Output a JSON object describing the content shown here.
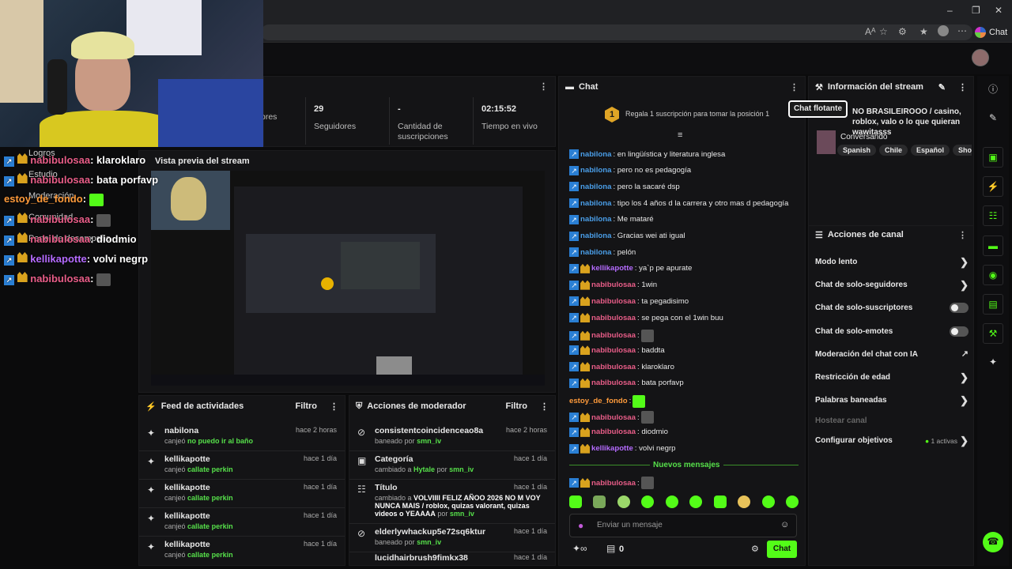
{
  "browser": {
    "copilot_label": "Chat",
    "font_size_glyph": "Aᴬ"
  },
  "stats": {
    "items": [
      {
        "value": "",
        "label": "ores"
      },
      {
        "value": "29",
        "label": "Seguidores"
      },
      {
        "value": "-",
        "label": "Cantidad de suscripciones"
      },
      {
        "value": "02:15:52",
        "label": "Tiempo en vivo"
      }
    ]
  },
  "preview": {
    "title": "Vista previa del stream"
  },
  "feed": {
    "title": "Feed de actividades",
    "filter": "Filtro",
    "rows": [
      {
        "name": "nabilona",
        "verb": "canjeó",
        "reward": "no puedo ir al baño",
        "time": "hace 2 horas"
      },
      {
        "name": "kellikapotte",
        "verb": "canjeó",
        "reward": "callate perkin",
        "time": "hace 1 día"
      },
      {
        "name": "kellikapotte",
        "verb": "canjeó",
        "reward": "callate perkin",
        "time": "hace 1 día"
      },
      {
        "name": "kellikapotte",
        "verb": "canjeó",
        "reward": "callate perkin",
        "time": "hace 1 día"
      },
      {
        "name": "kellikapotte",
        "verb": "canjeó",
        "reward": "callate perkin",
        "time": "hace 1 día"
      }
    ]
  },
  "mod": {
    "title": "Acciones de moderador",
    "filter": "Filtro",
    "rows": [
      {
        "name": "consistentcoincidenceao8a",
        "sub": "baneado por",
        "by": "smn_iv",
        "time": "hace 2 horas"
      },
      {
        "name": "Categoría",
        "sub": "cambiado a",
        "target": "Hytale",
        "by_pre": "por",
        "by": "smn_iv",
        "time": "hace 1 día"
      },
      {
        "name": "Título",
        "sub": "cambiado a",
        "target": "VOLVIIII FELIZ AÑOO 2026 NO M VOY NUNCA MAIS / roblox, quizas valorant, quizas videos o YEAAAA",
        "by_pre": "por",
        "by": "smn_iv",
        "time": "hace 1 día"
      },
      {
        "name": "elderlywhackup5e72sq6ktur",
        "sub": "baneado por",
        "by": "smn_iv",
        "time": "hace 1 día"
      },
      {
        "name": "lucidhairbrush9fimkx38",
        "sub": "",
        "by": "",
        "time": "hace 1 día"
      }
    ]
  },
  "chat": {
    "title": "Chat",
    "gift_rank": "1",
    "gift_text": "Regala 1 suscripción para tomar la posición 1",
    "floating_label": "Chat flotante",
    "messages": [
      {
        "user": "nabilona",
        "text": ": en lingüística y literatura inglesa",
        "c": "u-blue",
        "badges": 1
      },
      {
        "user": "nabilona",
        "text": ": pero no es pedagogía",
        "c": "u-blue",
        "badges": 1
      },
      {
        "user": "nabilona",
        "text": ": pero la sacaré dsp",
        "c": "u-blue",
        "badges": 1
      },
      {
        "user": "nabilona",
        "text": ": tipo los 4 años d la carrera y otro mas d pedagogía",
        "c": "u-blue",
        "badges": 1
      },
      {
        "user": "nabilona",
        "text": ": Me mataré",
        "c": "u-blue",
        "badges": 1
      },
      {
        "user": "nabilona",
        "text": ": Gracias wei ati igual",
        "c": "u-blue",
        "badges": 1
      },
      {
        "user": "nabilona",
        "text": ": pelón",
        "c": "u-blue",
        "badges": 1
      },
      {
        "user": "kellikapotte",
        "text": ": ya`p pe apurate",
        "c": "u-purple",
        "badges": 2
      },
      {
        "user": "nabibulosaa",
        "text": ": 1win",
        "c": "u-pink",
        "badges": 2
      },
      {
        "user": "nabibulosaa",
        "text": ": ta pegadisimo",
        "c": "u-pink",
        "badges": 2
      },
      {
        "user": "nabibulosaa",
        "text": ": se pega con el 1win buu",
        "c": "u-pink",
        "badges": 2
      },
      {
        "user": "nabibulosaa",
        "text": ":",
        "c": "u-pink",
        "badges": 2,
        "emote": true
      },
      {
        "user": "nabibulosaa",
        "text": ": baddta",
        "c": "u-pink",
        "badges": 2
      },
      {
        "user": "nabibulosaa",
        "text": ": klaroklaro",
        "c": "u-pink",
        "badges": 2
      },
      {
        "user": "nabibulosaa",
        "text": ": bata porfavp",
        "c": "u-pink",
        "badges": 2
      },
      {
        "user": "estoy_de_fondo",
        "text": ":",
        "c": "u-orange",
        "badges": 0,
        "emote": true
      },
      {
        "user": "nabibulosaa",
        "text": ":",
        "c": "u-pink",
        "badges": 2,
        "emote": true
      },
      {
        "user": "nabibulosaa",
        "text": ": diodmio",
        "c": "u-pink",
        "badges": 2
      },
      {
        "user": "kellikapotte",
        "text": ": volvi negrp",
        "c": "u-purple",
        "badges": 2
      }
    ],
    "new_messages": "Nuevos mensajes",
    "last": {
      "user": "nabibulosaa",
      "text": ":"
    },
    "placeholder": "Enviar un mensaje",
    "points": "0",
    "send_label": "Chat"
  },
  "info": {
    "title": "Información del stream",
    "stream_title": "NO BRASILEIROOO / casino, roblox, valo o lo que quieran wawitasss",
    "category": "Conversando",
    "tags": [
      "Spanish",
      "Chile",
      "Español",
      "Shooter"
    ]
  },
  "actions": {
    "title": "Acciones de canal",
    "items": [
      {
        "label": "Modo lento",
        "kind": "arrow"
      },
      {
        "label": "Chat de solo-seguidores",
        "kind": "arrow"
      },
      {
        "label": "Chat de solo-suscriptores",
        "kind": "toggle"
      },
      {
        "label": "Chat de solo-emotes",
        "kind": "toggle"
      },
      {
        "label": "Moderación del chat con IA",
        "kind": "ext"
      },
      {
        "label": "Restricción de edad",
        "kind": "arrow"
      },
      {
        "label": "Palabras baneadas",
        "kind": "arrow"
      },
      {
        "label": "Hostear canal",
        "kind": "disabled"
      },
      {
        "label": "Configurar objetivos",
        "kind": "arrow"
      }
    ],
    "goals_active": "1 activas"
  },
  "overlay": {
    "messages": [
      {
        "user": "nabibulosaa",
        "text": ": klaroklaro",
        "c": "u-pink"
      },
      {
        "user": "nabibulosaa",
        "text": ": bata porfavp",
        "c": "u-pink"
      },
      {
        "user": "estoy_de_fondo",
        "text": ":",
        "c": "u-orange"
      },
      {
        "user": "nabibulosaa",
        "text": ":",
        "c": "u-pink"
      },
      {
        "user": "nabibulosaa",
        "text": ": diodmio",
        "c": "u-pink"
      },
      {
        "user": "kellikapotte",
        "text": ": volvi negrp",
        "c": "u-purple"
      },
      {
        "user": "nabibulosaa",
        "text": ":",
        "c": "u-pink"
      }
    ],
    "menu": [
      "Logros",
      "Estudio",
      "Moderación",
      "Comunidad",
      "Panel de desempeño"
    ]
  },
  "colors": {
    "accent": "#53fc18",
    "pink": "#e85d88",
    "blue": "#4a9ee8"
  }
}
